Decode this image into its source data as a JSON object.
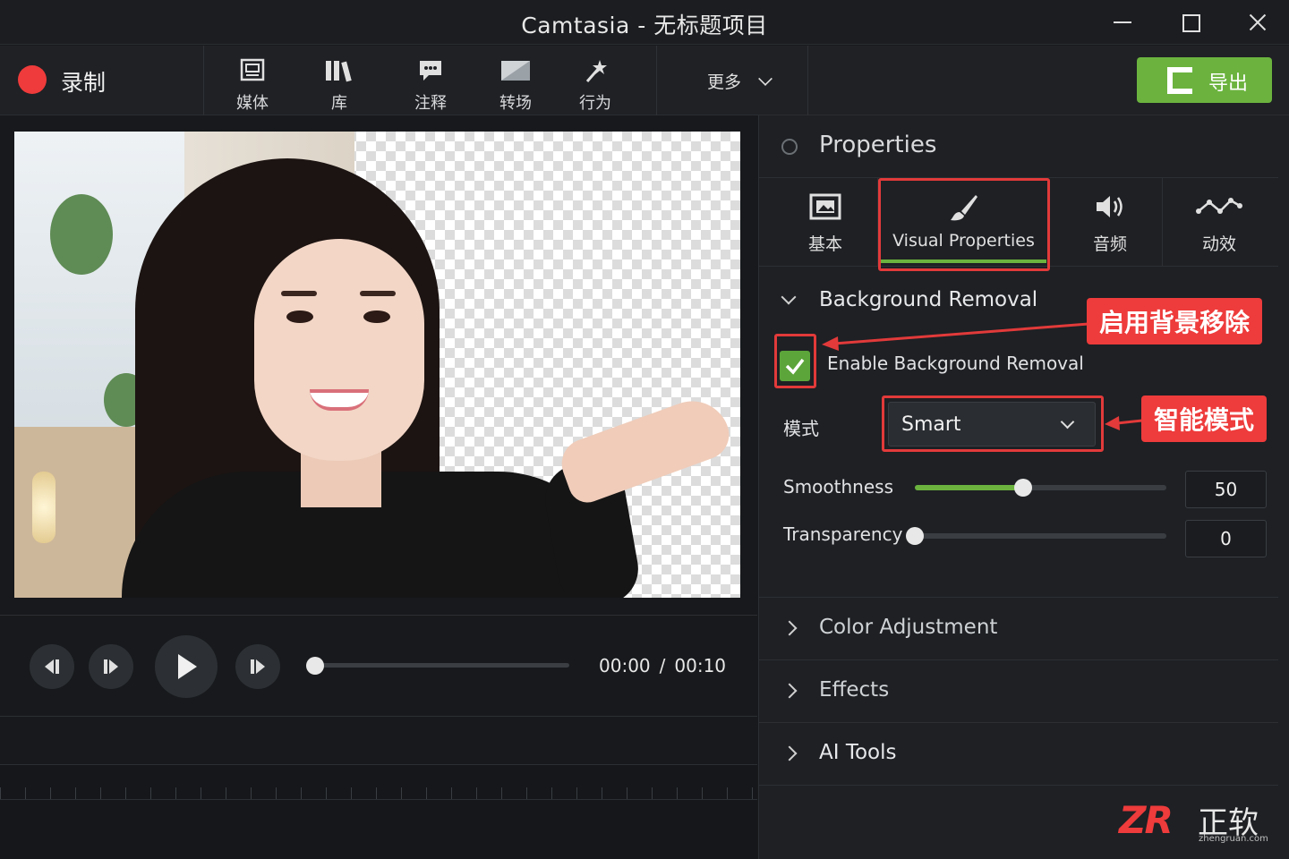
{
  "window": {
    "title": "Camtasia - 无标题项目"
  },
  "toolbar": {
    "record_label": "录制",
    "tools": [
      {
        "label": "媒体",
        "icon": "media-icon"
      },
      {
        "label": "库",
        "icon": "library-icon"
      },
      {
        "label": "注释",
        "icon": "annotation-icon"
      },
      {
        "label": "转场",
        "icon": "transition-icon"
      },
      {
        "label": "行为",
        "icon": "behavior-icon"
      }
    ],
    "more_label": "更多",
    "export_label": "导出"
  },
  "player": {
    "current_time": "00:00",
    "separator": "/",
    "total_time": "00:10",
    "progress": 0
  },
  "properties": {
    "title": "Properties",
    "tabs": [
      {
        "label": "基本",
        "icon": "basic-icon"
      },
      {
        "label": "Visual Properties",
        "icon": "brush-icon",
        "active": true
      },
      {
        "label": "音频",
        "icon": "speaker-icon"
      },
      {
        "label": "动效",
        "icon": "animation-icon"
      }
    ],
    "background_removal": {
      "heading": "Background Removal",
      "enable_label": "Enable Background Removal",
      "enabled": true,
      "mode_label": "模式",
      "mode_value": "Smart",
      "smoothness_label": "Smoothness",
      "smoothness_value": "50",
      "smoothness_fraction": 0.43,
      "transparency_label": "Transparency",
      "transparency_value": "0",
      "transparency_fraction": 0
    },
    "collapsed_sections": [
      "Color Adjustment",
      "Effects",
      "AI Tools"
    ]
  },
  "annotations": {
    "enable_callout": "启用背景移除",
    "mode_callout": "智能模式"
  },
  "watermark": {
    "logo": "ZR",
    "brand": "正软",
    "url": "zhengruan.com"
  },
  "colors": {
    "accent_green": "#6bb33e",
    "record_red": "#ef3b3b",
    "highlight_red": "#e23a3a"
  }
}
